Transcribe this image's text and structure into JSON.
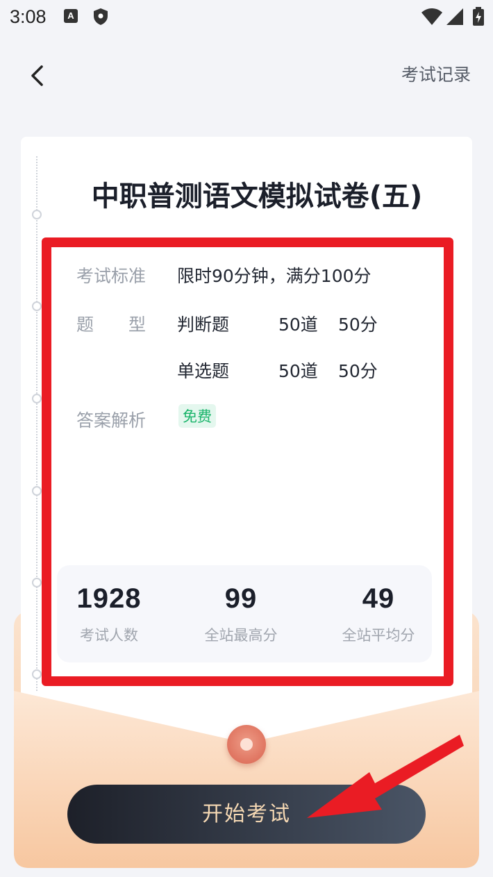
{
  "status_bar": {
    "time": "3:08",
    "icons": [
      "a-notification-icon",
      "shield-icon",
      "wifi-icon",
      "signal-icon",
      "battery-icon"
    ]
  },
  "header": {
    "back_icon": "chevron-left-icon",
    "record_label": "考试记录"
  },
  "paper": {
    "title": "中职普测语文模拟试卷(五)"
  },
  "info": {
    "standard_label": "考试标准",
    "standard_value": "限时90分钟，满分100分",
    "type_label": "题　　型",
    "question_types": [
      {
        "name": "判断题",
        "count": "50道",
        "score": "50分"
      },
      {
        "name": "单选题",
        "count": "50道",
        "score": "50分"
      }
    ],
    "analysis_label": "答案解析",
    "analysis_badge": "免费"
  },
  "stats": [
    {
      "value": "1928",
      "label": "考试人数"
    },
    {
      "value": "99",
      "label": "全站最高分"
    },
    {
      "value": "49",
      "label": "全站平均分"
    }
  ],
  "start_button": {
    "label": "开始考试"
  },
  "colors": {
    "highlight": "#ea1c24",
    "badge_text": "#19b46a",
    "badge_bg": "#e4f7ee",
    "button_gradient_start": "#1d2029",
    "button_gradient_end": "#4a5566",
    "button_text": "#f6d9b4",
    "envelope": "#f8caa4"
  }
}
